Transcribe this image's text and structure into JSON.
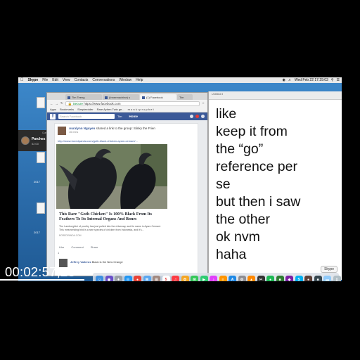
{
  "menubar": {
    "app_name": "Skype",
    "items": [
      "File",
      "Edit",
      "View",
      "Contacts",
      "Conversations",
      "Window",
      "Help"
    ],
    "clock": "Wed Feb 22  17:29:03"
  },
  "desktop": {
    "labels": [
      "2017",
      "2017"
    ]
  },
  "skype_call": {
    "title": "Current Call",
    "contact": "Parches",
    "duration": "52:00"
  },
  "chrome": {
    "tabs": [
      "Tim Teeng",
      "(Innermachine) s",
      "(1) Facebook",
      "Tim"
    ],
    "url_secure": "Secure",
    "url": "https://www.facebook.com",
    "bookmarks": [
      "Apps",
      "Bookmarks",
      "Simpleedder",
      "Rare Ayhen Twin ge...",
      "m o n k • p r o p h e t"
    ]
  },
  "facebook": {
    "search_placeholder": "Search Facebook",
    "user": "Tim",
    "home": "Home",
    "post": {
      "author": "Auralynn Nguyen",
      "shared_text": "shared a link to the group: Slinky the Frien",
      "meta": "16 mins",
      "link": "http://www.boredpanda.com/goth-black-chicken-ayam-cemani/...",
      "headline": "This Rare \"Goth Chicken\" Is 100% Black From Its Feathers To Its Internal Organs And Bones",
      "description": "The Lamborghini of poultry has just pulled into the driveway, and its name is Ayam Cemani. This mesmerizing bird is a rare species of chicken from Indonesia, and it's...",
      "source": "BOREDPANDA.COM",
      "actions": [
        "Like",
        "Comment",
        "Share"
      ],
      "reactions": "1",
      "comment_author": "Jeffrey Valleros",
      "comment_text": "Black is the New Orange"
    }
  },
  "notes": {
    "toolbar": "Untitled 3",
    "lines": [
      "like",
      "keep it from",
      "the “go”",
      "reference per",
      "se",
      "but then i saw",
      "the other",
      "ok nvm",
      "haha"
    ],
    "button": "Skype"
  },
  "dock": {
    "icons": [
      {
        "name": "finder-icon",
        "glyph": "☺",
        "color": "#3d8fe0"
      },
      {
        "name": "siri-icon",
        "glyph": "◉",
        "color": "#6a4fc9"
      },
      {
        "name": "launchpad-icon",
        "glyph": "✦",
        "color": "#9aa0a6"
      },
      {
        "name": "safari-icon",
        "glyph": "☉",
        "color": "#2196f3"
      },
      {
        "name": "chrome-icon",
        "glyph": "●",
        "color": "#e94235"
      },
      {
        "name": "mail-icon",
        "glyph": "✉",
        "color": "#5aa7f0"
      },
      {
        "name": "contacts-icon",
        "glyph": "☰",
        "color": "#a1887f"
      },
      {
        "name": "calendar-icon",
        "glyph": "5",
        "color": "#ffffff"
      },
      {
        "name": "music-icon",
        "glyph": "♫",
        "color": "#fc3c44"
      },
      {
        "name": "photos-icon",
        "glyph": "✿",
        "color": "#f5a623"
      },
      {
        "name": "messages-icon",
        "glyph": "✉",
        "color": "#34c759"
      },
      {
        "name": "facetime-icon",
        "glyph": "▶",
        "color": "#2ecc71"
      },
      {
        "name": "itunes-icon",
        "glyph": "♪",
        "color": "#e040fb"
      },
      {
        "name": "books-icon",
        "glyph": "≡",
        "color": "#ff9500"
      },
      {
        "name": "appstore-icon",
        "glyph": "A",
        "color": "#1e88e5"
      },
      {
        "name": "preferences-icon",
        "glyph": "⚙",
        "color": "#8e8e93"
      },
      {
        "name": "vlc-icon",
        "glyph": "▲",
        "color": "#ff8800"
      },
      {
        "name": "finalcut-icon",
        "glyph": "✂",
        "color": "#333333"
      },
      {
        "name": "spotify-icon",
        "glyph": "●",
        "color": "#1db954"
      },
      {
        "name": "app-icon",
        "glyph": "■",
        "color": "#2e7d32"
      },
      {
        "name": "app-icon-2",
        "glyph": "◆",
        "color": "#7b1fa2"
      },
      {
        "name": "skype-icon",
        "glyph": "S",
        "color": "#00aff0"
      },
      {
        "name": "app-icon-3",
        "glyph": "●",
        "color": "#5d4037"
      },
      {
        "name": "app-icon-4",
        "glyph": "■",
        "color": "#37474f"
      },
      {
        "name": "folder-icon",
        "glyph": "▬",
        "color": "#90caf9"
      },
      {
        "name": "trash-icon",
        "glyph": "▯",
        "color": "#b0bec5"
      }
    ]
  },
  "timecode": "00:02:57;28"
}
